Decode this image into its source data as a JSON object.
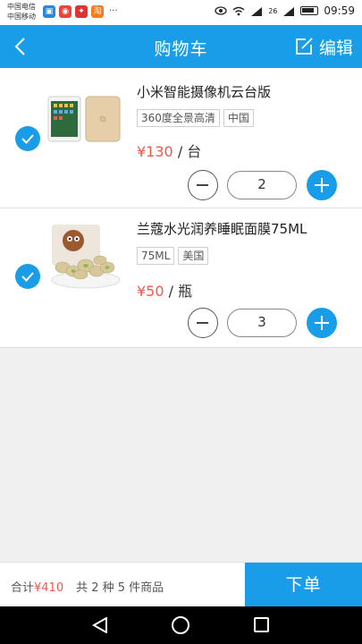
{
  "status_bar": {
    "carrier_1": "中国电信",
    "carrier_2": "中国移动",
    "network": "26",
    "time": "09:59",
    "notification_icons": [
      "app-icon-blue",
      "weibo-icon",
      "netease-icon",
      "taobao-icon"
    ],
    "more": "···"
  },
  "header": {
    "title": "购物车",
    "edit_label": "编辑"
  },
  "cart": {
    "items": [
      {
        "name": "小米智能摄像机云台版",
        "tags": [
          "360度全景高清",
          "中国"
        ],
        "price": "¥130",
        "unit": "/ 台",
        "quantity": "2",
        "checked": true,
        "image": "ipad-tablet-image"
      },
      {
        "name": "兰蔻水光润养睡眠面膜75ML",
        "tags": [
          "75ML",
          "美国"
        ],
        "price": "¥50",
        "unit": "/ 瓶",
        "quantity": "3",
        "checked": true,
        "image": "pistachio-snack-image"
      }
    ]
  },
  "footer": {
    "total_label": "合计",
    "total_amount": "¥410",
    "count_text": "共 2 种 5 件商品",
    "order_label": "下单"
  },
  "colors": {
    "accent": "#1a9de8",
    "price": "#f4564a"
  }
}
